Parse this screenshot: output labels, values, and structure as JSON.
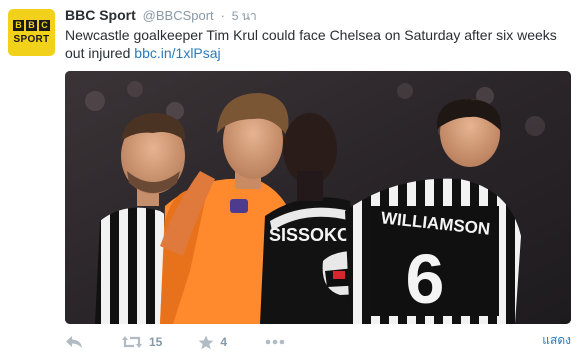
{
  "avatar": {
    "logo_letters": [
      "B",
      "B",
      "C"
    ],
    "logo_word": "SPORT"
  },
  "tweet": {
    "display_name": "BBC Sport",
    "handle": "@BBCSport",
    "separator": "·",
    "timestamp": "5 นา",
    "text": "Newcastle goalkeeper Tim Krul could face Chelsea on Saturday after six weeks out injured",
    "link_text": "bbc.in/1xlPsaj"
  },
  "photo": {
    "shirt_names": [
      "SISSOKO",
      "WILLIAMSON"
    ],
    "shirt_number": "6"
  },
  "actions": {
    "reply_icon": "reply-icon",
    "retweet_icon": "retweet-icon",
    "retweet_count": "15",
    "favorite_icon": "star-icon",
    "favorite_count": "4",
    "more_icon": "more-dots-icon"
  },
  "show_link": "แสดง",
  "colors": {
    "link": "#2b7bb9",
    "text": "#292f33",
    "muted": "#8899a6",
    "action_icon": "#b1bbc3",
    "avatar_bg": "#f2d11b"
  }
}
